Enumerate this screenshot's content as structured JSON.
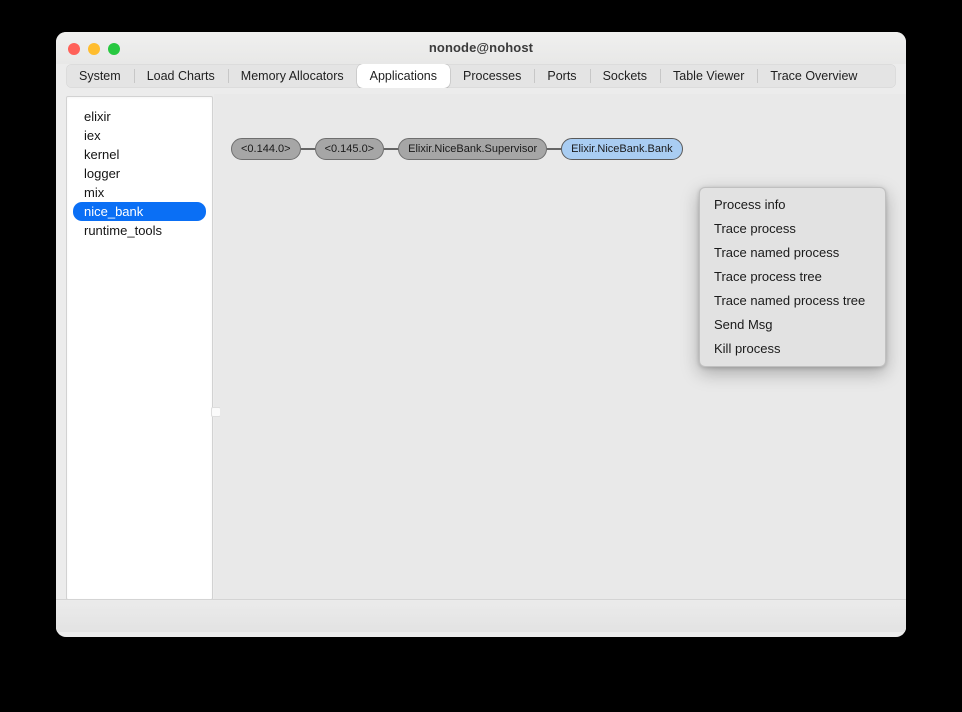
{
  "window": {
    "title": "nonode@nohost",
    "traffic_lights": [
      {
        "name": "close",
        "color": "#ff6159"
      },
      {
        "name": "minimize",
        "color": "#ffbd2e"
      },
      {
        "name": "maximize",
        "color": "#28c840"
      }
    ]
  },
  "tabs": [
    {
      "label": "System",
      "active": false
    },
    {
      "label": "Load Charts",
      "active": false
    },
    {
      "label": "Memory Allocators",
      "active": false
    },
    {
      "label": "Applications",
      "active": true
    },
    {
      "label": "Processes",
      "active": false
    },
    {
      "label": "Ports",
      "active": false
    },
    {
      "label": "Sockets",
      "active": false
    },
    {
      "label": "Table Viewer",
      "active": false
    },
    {
      "label": "Trace Overview",
      "active": false
    }
  ],
  "sidebar": {
    "items": [
      {
        "label": "elixir",
        "selected": false
      },
      {
        "label": "iex",
        "selected": false
      },
      {
        "label": "kernel",
        "selected": false
      },
      {
        "label": "logger",
        "selected": false
      },
      {
        "label": "mix",
        "selected": false
      },
      {
        "label": "nice_bank",
        "selected": true
      },
      {
        "label": "runtime_tools",
        "selected": false
      }
    ],
    "selection_color": "#0a6ff5"
  },
  "process_tree": {
    "nodes": [
      {
        "label": "<0.144.0>",
        "selected": false
      },
      {
        "label": "<0.145.0>",
        "selected": false
      },
      {
        "label": "Elixir.NiceBank.Supervisor",
        "selected": false
      },
      {
        "label": "Elixir.NiceBank.Bank",
        "selected": true
      }
    ],
    "node_fill": "#a6a6a6",
    "node_selected_fill": "#a9cdf2",
    "edge_color": "#666666"
  },
  "context_menu": {
    "items": [
      {
        "label": "Process info"
      },
      {
        "label": "Trace process"
      },
      {
        "label": "Trace named process"
      },
      {
        "label": "Trace process tree"
      },
      {
        "label": "Trace named process tree"
      },
      {
        "label": "Send Msg"
      },
      {
        "label": "Kill process"
      }
    ]
  },
  "statusbar": {
    "text": ""
  }
}
